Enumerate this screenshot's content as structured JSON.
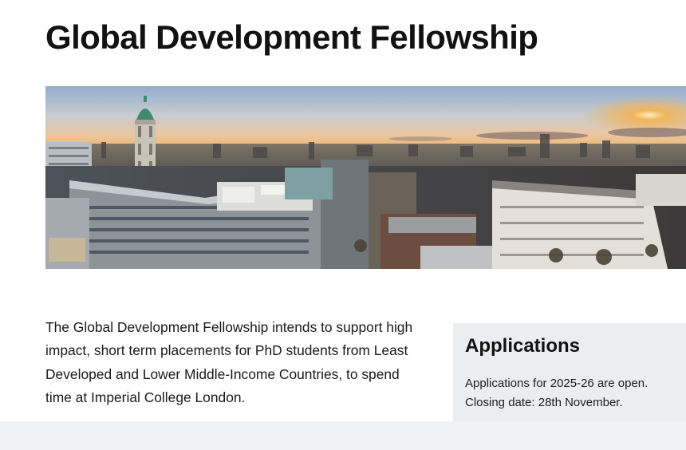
{
  "page": {
    "title": "Global Development Fellowship"
  },
  "hero": {
    "alt": "Panoramic view over Imperial College London campus and surrounding rooftops at sunset"
  },
  "intro": {
    "text": "The Global Development Fellowship intends to support high impact, short term placements for PhD students from Least Developed and Lower Middle-Income Countries, to spend time at Imperial College London."
  },
  "applications": {
    "heading": "Applications",
    "status": "Applications for 2025-26 are open.",
    "closing": "Closing date: 28th November."
  },
  "colors": {
    "sky_top": "#9fb8d2",
    "sky_glow": "#f3a24a",
    "sidebar_bg": "#ebeeef",
    "footer_bg": "#f1f2f4"
  }
}
